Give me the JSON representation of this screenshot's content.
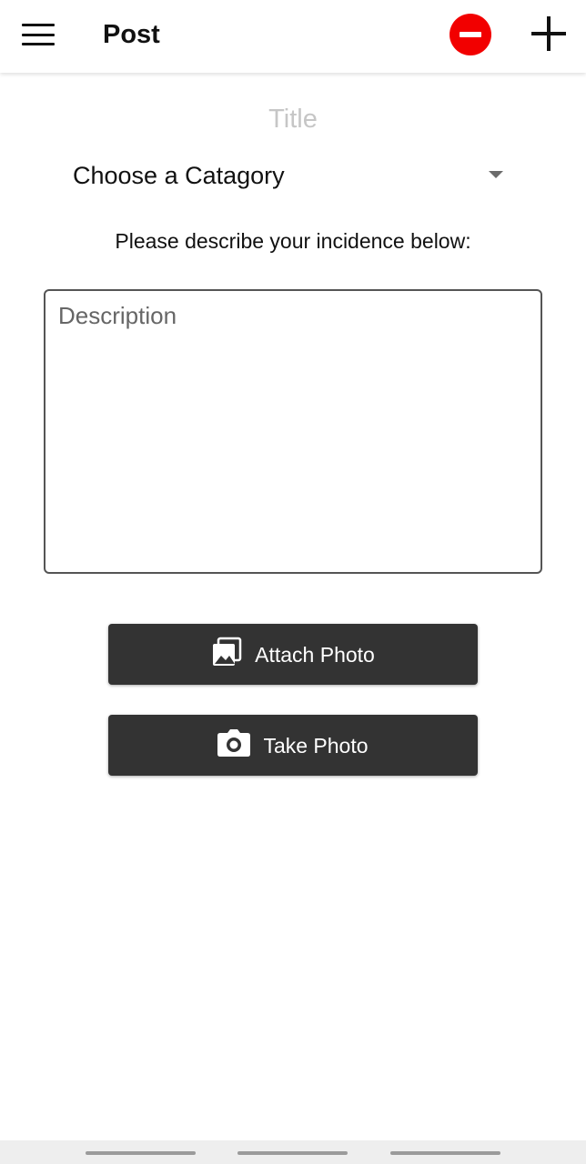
{
  "header": {
    "title": "Post",
    "menu_icon": "hamburger-menu-icon",
    "remove_icon": "remove-circle-icon",
    "add_icon": "plus-icon",
    "accent_color": "#f20000"
  },
  "form": {
    "title_placeholder": "Title",
    "title_value": "",
    "category": {
      "selected": "Choose a Catagory",
      "icon": "dropdown-arrow-icon"
    },
    "prompt": "Please describe your incidence below:",
    "description_placeholder": "Description",
    "description_value": ""
  },
  "actions": {
    "attach_label": "Attach Photo",
    "attach_icon": "photo-library-icon",
    "take_label": "Take Photo",
    "take_icon": "camera-icon",
    "button_color": "#333333"
  }
}
